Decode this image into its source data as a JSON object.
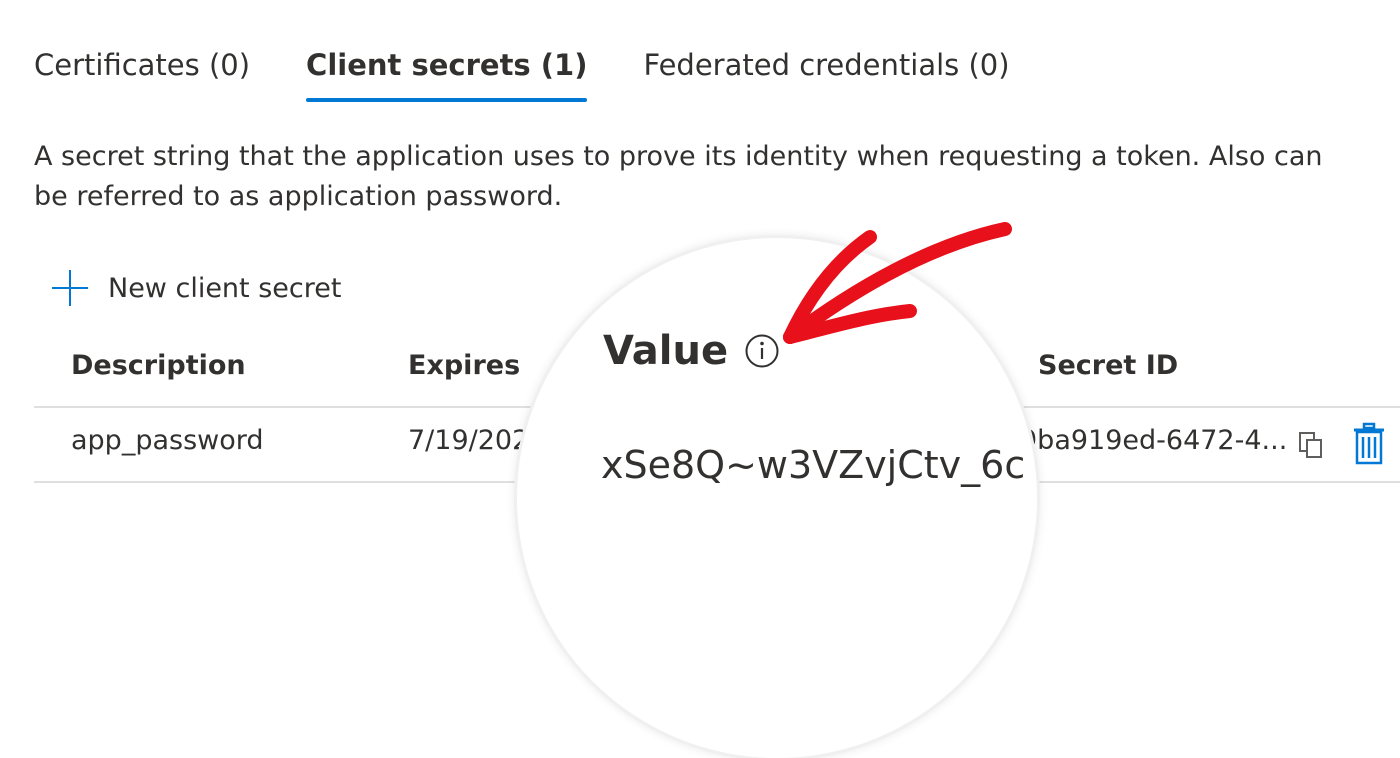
{
  "tabs": [
    {
      "label": "Certificates (0)",
      "active": false
    },
    {
      "label": "Client secrets (1)",
      "active": true
    },
    {
      "label": "Federated credentials (0)",
      "active": false
    }
  ],
  "description": "A secret string that the application uses to prove its identity when requesting a token. Also can be referred to as application password.",
  "new_secret_label": "New client secret",
  "table": {
    "headers": {
      "description": "Description",
      "expires": "Expires",
      "value": "Value",
      "secret_id": "Secret ID"
    },
    "rows": [
      {
        "description": "app_password",
        "expires": "7/19/202",
        "value": "xSe8Q~w3VZvjCtv_6c",
        "secret_id": "9ba919ed-6472-4..."
      }
    ]
  },
  "colors": {
    "accent": "#0078d4",
    "annotation": "#e8101a",
    "text": "#323130",
    "divider": "#e1dfdd"
  }
}
